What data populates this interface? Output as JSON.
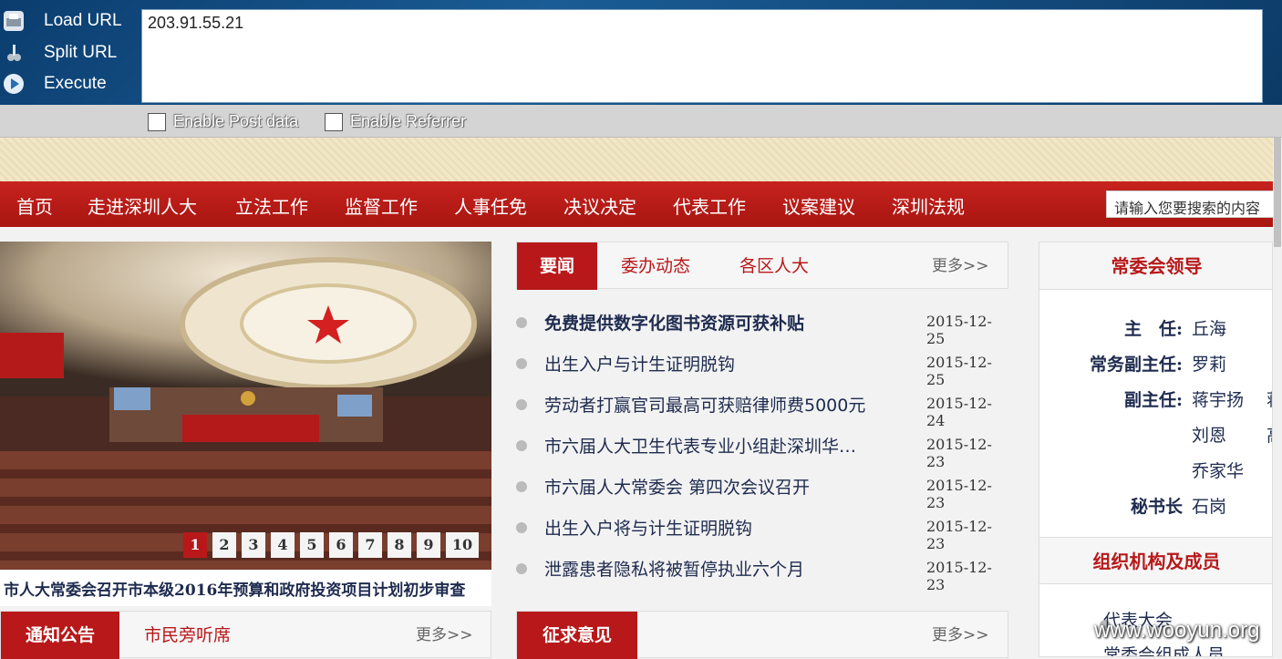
{
  "toolbar": {
    "load_url": "Load URL",
    "split_url": "Split URL",
    "execute": "Execute",
    "url_value": "203.91.55.21",
    "enable_post": "Enable Post data",
    "enable_referrer": "Enable Referrer"
  },
  "nav": {
    "items": [
      "首页",
      "走进深圳人大",
      "立法工作",
      "监督工作",
      "人事任免",
      "决议决定",
      "代表工作",
      "议案建议",
      "深圳法规"
    ],
    "search_placeholder": "请输入您要搜索的内容"
  },
  "slideshow": {
    "pages": [
      "1",
      "2",
      "3",
      "4",
      "5",
      "6",
      "7",
      "8",
      "9",
      "10"
    ],
    "active_page": "1",
    "caption": "市人大常委会召开市本级2016年预算和政府投资项目计划初步审查"
  },
  "news_panel": {
    "active_tab": "要闻",
    "tabs": [
      "委办动态",
      "各区人大"
    ],
    "more": "更多>>",
    "items": [
      {
        "title": "免费提供数字化图书资源可获补贴",
        "date": "2015-12-25"
      },
      {
        "title": "出生入户与计生证明脱钩",
        "date": "2015-12-25"
      },
      {
        "title": "劳动者打赢官司最高可获赔律师费5000元",
        "date": "2015-12-24"
      },
      {
        "title": "市六届人大卫生代表专业小组赴深圳华…",
        "date": "2015-12-23"
      },
      {
        "title": "市六届人大常委会 第四次会议召开",
        "date": "2015-12-23"
      },
      {
        "title": "出生入户将与计生证明脱钩",
        "date": "2015-12-23"
      },
      {
        "title": "泄露患者隐私将被暂停执业六个月",
        "date": "2015-12-23"
      }
    ]
  },
  "notice_panel": {
    "active_tab": "通知公告",
    "tab": "市民旁听席",
    "more": "更多>>"
  },
  "opinion_panel": {
    "active_tab": "征求意见",
    "more": "更多>>"
  },
  "leaders": {
    "title": "常委会领导",
    "rows": [
      {
        "role": "主　任:",
        "name": "丘海",
        "name2": ""
      },
      {
        "role": "常务副主任:",
        "name": "罗莉",
        "name2": ""
      },
      {
        "role": "副主任:",
        "name": "蒋宇扬",
        "name2": "蒋"
      },
      {
        "role": "",
        "name": "刘恩",
        "name2": "高"
      },
      {
        "role": "",
        "name": "乔家华",
        "name2": ""
      },
      {
        "role": "秘书长",
        "name": "石岗",
        "name2": ""
      }
    ]
  },
  "org": {
    "title": "组织机构及成员",
    "items": [
      "代表大会",
      "常委会组成人员"
    ]
  },
  "watermark": "www.wooyun.org"
}
